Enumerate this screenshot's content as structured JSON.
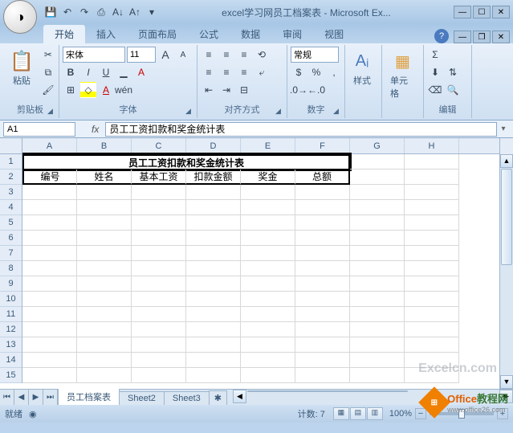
{
  "window": {
    "title": "excel学习网员工档案表 - Microsoft Ex..."
  },
  "qat": {
    "save": "💾",
    "undo": "↶",
    "redo": "↷",
    "print": "",
    "sort_asc": "A↓",
    "sort_desc": "A↑",
    "more": "▾"
  },
  "tabs": {
    "home": "开始",
    "insert": "插入",
    "layout": "页面布局",
    "formulas": "公式",
    "data": "数据",
    "review": "审阅",
    "view": "视图"
  },
  "ribbon": {
    "clipboard": {
      "label": "剪贴板",
      "paste": "粘贴"
    },
    "font": {
      "label": "字体",
      "name": "宋体",
      "size": "11",
      "grow": "A",
      "shrink": "A"
    },
    "align": {
      "label": "对齐方式"
    },
    "number": {
      "label": "数字",
      "format": "常规"
    },
    "styles": {
      "label": "样式",
      "btn": "样式"
    },
    "cells": {
      "label": "单元格",
      "btn": "单元格"
    },
    "editing": {
      "label": "编辑"
    }
  },
  "formula_bar": {
    "name_box": "A1",
    "fx": "fx",
    "value": "员工工资扣款和奖金统计表"
  },
  "columns": [
    "A",
    "B",
    "C",
    "D",
    "E",
    "F",
    "G",
    "H"
  ],
  "rows": [
    "1",
    "2",
    "3",
    "4",
    "5",
    "6",
    "7",
    "8",
    "9",
    "10",
    "11",
    "12",
    "13",
    "14",
    "15"
  ],
  "sheet_data": {
    "title": "员工工资扣款和奖金统计表",
    "headers": [
      "编号",
      "姓名",
      "基本工资",
      "扣款金额",
      "奖金",
      "总额"
    ]
  },
  "sheet_tabs": {
    "s1": "员工档案表",
    "s2": "Sheet2",
    "s3": "Sheet3"
  },
  "status": {
    "ready": "就绪",
    "count": "计数: 7",
    "zoom": "100%"
  },
  "watermarks": {
    "w1": "Excelcn.com",
    "w2a": "Office",
    "w2b": "教程网",
    "w2c": "www.office26.com"
  }
}
